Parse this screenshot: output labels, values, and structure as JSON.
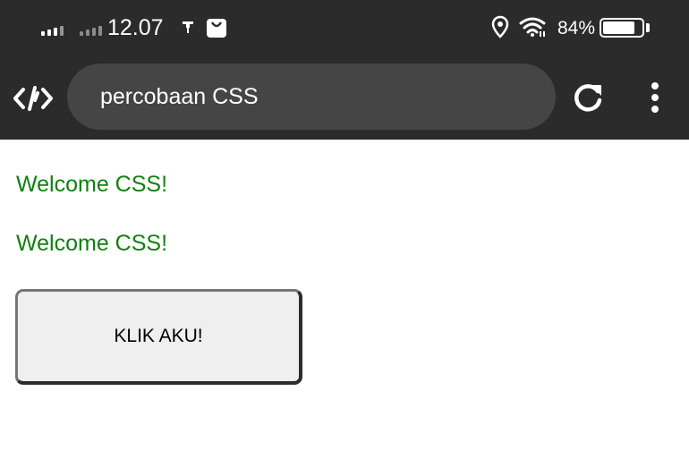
{
  "status_bar": {
    "time": "12.07",
    "battery_percent": "84%",
    "battery_level": 0.84,
    "icons": [
      "signal-bars-icon",
      "signal-bars-dim-icon",
      "usb-icon",
      "shopping-bag-icon",
      "location-icon",
      "wifi-icon",
      "battery-icon"
    ]
  },
  "browser": {
    "logo_icon": "code-editor-logo-icon",
    "address_text": "percobaan CSS",
    "reload_icon": "reload-icon",
    "menu_icon": "more-vert-icon"
  },
  "page": {
    "lines": [
      "Welcome CSS!",
      "Welcome CSS!"
    ],
    "button_label": "KLIK AKU!",
    "text_color": "#118011"
  },
  "colors": {
    "chrome_background": "#2b2b2b",
    "address_bar": "#454545",
    "page_background": "#ffffff",
    "button_background": "#efefef"
  }
}
